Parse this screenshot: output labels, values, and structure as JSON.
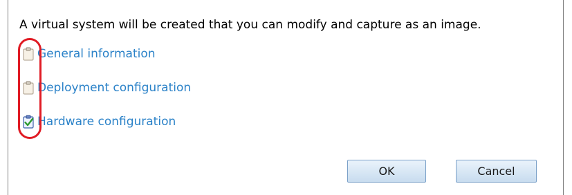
{
  "dialog": {
    "intro_text": "A virtual system will be created that you can modify and capture as an image."
  },
  "steps": [
    {
      "label": "General information",
      "icon": "clipboard-icon",
      "completed": false
    },
    {
      "label": "Deployment configuration",
      "icon": "clipboard-icon",
      "completed": false
    },
    {
      "label": "Hardware configuration",
      "icon": "clipboard-check-icon",
      "completed": true
    }
  ],
  "buttons": {
    "ok_label": "OK",
    "cancel_label": "Cancel"
  },
  "colors": {
    "link": "#2b82c8",
    "highlight": "#e01b24",
    "button_border": "#7aa0c8"
  }
}
